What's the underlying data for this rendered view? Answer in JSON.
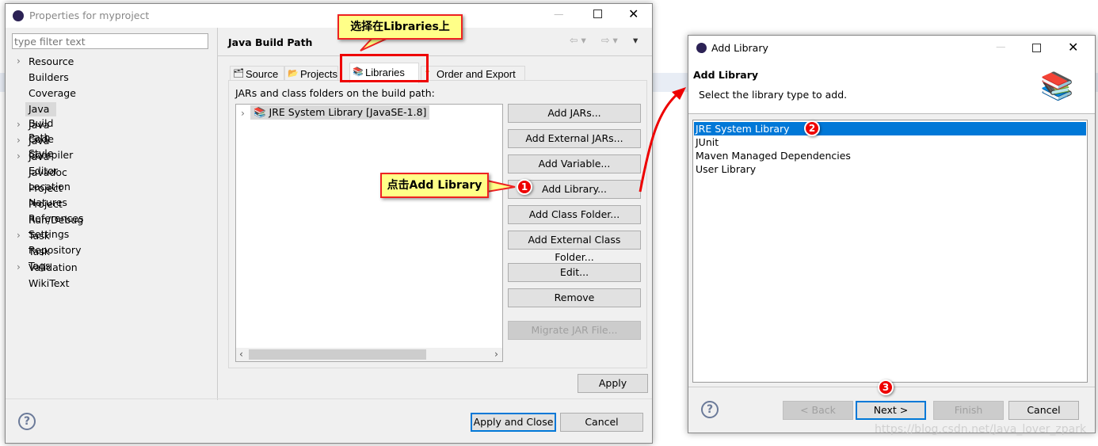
{
  "properties_dialog": {
    "title": "Properties for myproject",
    "filter_placeholder": "type filter text",
    "tree": [
      "Resource",
      "Builders",
      "Coverage",
      "Java Build Path",
      "Java Code Style",
      "Java Compiler",
      "Java Editor",
      "Javadoc Location",
      "Project Natures",
      "Project References",
      "Run/Debug Settings",
      "Task Repository",
      "Task Tags",
      "Validation",
      "WikiText"
    ],
    "tree_expandable": [
      true,
      false,
      false,
      false,
      true,
      true,
      true,
      false,
      false,
      false,
      false,
      true,
      false,
      true,
      false
    ],
    "selected": "Java Build Path",
    "page_title": "Java Build Path",
    "tabs": [
      "Source",
      "Projects",
      "Libraries",
      "Order and Export"
    ],
    "active_tab": "Libraries",
    "list_label": "JARs and class folders on the build path:",
    "list_items": [
      "JRE System Library [JavaSE-1.8]"
    ],
    "buttons": [
      "Add JARs...",
      "Add External JARs...",
      "Add Variable...",
      "Add Library...",
      "Add Class Folder...",
      "Add External Class Folder...",
      "Edit...",
      "Remove",
      "Migrate JAR File..."
    ],
    "apply": "Apply",
    "apply_close": "Apply and Close",
    "cancel": "Cancel"
  },
  "annotations": {
    "callout_tab": "选择在Libraries上",
    "callout_add": "点击Add Library",
    "badge1": "1",
    "badge2": "2",
    "badge3": "3"
  },
  "add_library_dialog": {
    "title": "Add Library",
    "header": "Add Library",
    "subtitle": "Select the library type to add.",
    "items": [
      "JRE System Library",
      "JUnit",
      "Maven Managed Dependencies",
      "User Library"
    ],
    "selected": "JRE System Library",
    "back": "< Back",
    "next": "Next >",
    "finish": "Finish",
    "cancel": "Cancel"
  },
  "watermark": "https://blog.csdn.net/Java_lover_zpark",
  "colors": {
    "selection": "#0078d7",
    "callout": "#ffff88",
    "annotation_red": "#e00000"
  }
}
